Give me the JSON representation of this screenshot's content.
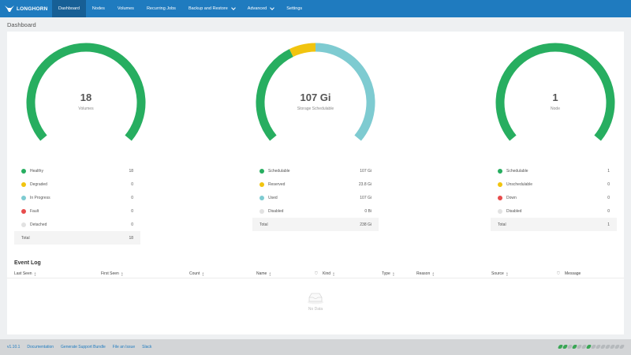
{
  "app": {
    "logo_text": "LONGHORN"
  },
  "nav": [
    {
      "label": "Dashboard",
      "active": true,
      "dropdown": false
    },
    {
      "label": "Nodes",
      "active": false,
      "dropdown": false
    },
    {
      "label": "Volumes",
      "active": false,
      "dropdown": false
    },
    {
      "label": "Recurring Jobs",
      "active": false,
      "dropdown": false
    },
    {
      "label": "Backup and Restore",
      "active": false,
      "dropdown": true
    },
    {
      "label": "Advanced",
      "active": false,
      "dropdown": true
    },
    {
      "label": "Settings",
      "active": false,
      "dropdown": false
    }
  ],
  "page": {
    "title": "Dashboard"
  },
  "colors": {
    "green": "#27ae60",
    "yellow": "#f1c40f",
    "teal": "#7ecbd1",
    "red": "#e74c4c",
    "grey": "#e2e2e2",
    "brand": "#1f7bbf"
  },
  "volumes": {
    "value": "18",
    "label": "Volumes",
    "segments": [
      {
        "fraction": 1.0,
        "color": "#27ae60"
      }
    ],
    "rows": [
      {
        "name": "Healthy",
        "value": "18",
        "color": "#27ae60"
      },
      {
        "name": "Degraded",
        "value": "0",
        "color": "#f1c40f"
      },
      {
        "name": "In Progress",
        "value": "0",
        "color": "#7ecbd1"
      },
      {
        "name": "Fault",
        "value": "0",
        "color": "#e74c4c"
      },
      {
        "name": "Detached",
        "value": "0",
        "color": "#e2e2e2"
      }
    ],
    "total_label": "Total",
    "total_value": "18"
  },
  "storage": {
    "value": "107 Gi",
    "label": "Storage Schedulable",
    "segments": [
      {
        "fraction": 0.4,
        "color": "#27ae60"
      },
      {
        "fraction": 0.1,
        "color": "#f1c40f"
      },
      {
        "fraction": 0.5,
        "color": "#7ecbd1"
      }
    ],
    "rows": [
      {
        "name": "Schedulable",
        "value": "107 Gi",
        "color": "#27ae60"
      },
      {
        "name": "Reserved",
        "value": "23.8 Gi",
        "color": "#f1c40f"
      },
      {
        "name": "Used",
        "value": "107 Gi",
        "color": "#7ecbd1"
      },
      {
        "name": "Disabled",
        "value": "0 Bi",
        "color": "#e2e2e2"
      }
    ],
    "total_label": "Total",
    "total_value": "238 Gi"
  },
  "nodes": {
    "value": "1",
    "label": "Node",
    "segments": [
      {
        "fraction": 1.0,
        "color": "#27ae60"
      }
    ],
    "rows": [
      {
        "name": "Schedulable",
        "value": "1",
        "color": "#27ae60"
      },
      {
        "name": "Unschedulable",
        "value": "0",
        "color": "#f1c40f"
      },
      {
        "name": "Down",
        "value": "0",
        "color": "#e74c4c"
      },
      {
        "name": "Disabled",
        "value": "0",
        "color": "#e2e2e2"
      }
    ],
    "total_label": "Total",
    "total_value": "1"
  },
  "event_log": {
    "title": "Event Log",
    "columns": [
      {
        "label": "Last Seen",
        "sortable": true,
        "filter": false
      },
      {
        "label": "First Seen",
        "sortable": true,
        "filter": false
      },
      {
        "label": "Count",
        "sortable": true,
        "filter": false
      },
      {
        "label": "Name",
        "sortable": true,
        "filter": true
      },
      {
        "label": "Kind",
        "sortable": true,
        "filter": false
      },
      {
        "label": "Type",
        "sortable": true,
        "filter": false
      },
      {
        "label": "Reason",
        "sortable": true,
        "filter": false
      },
      {
        "label": "Source",
        "sortable": true,
        "filter": true
      },
      {
        "label": "Message",
        "sortable": false,
        "filter": false
      }
    ],
    "empty_text": "No Data"
  },
  "footer": {
    "version": "v1.10.1",
    "links": [
      "Documentation",
      "Generate Support Bundle",
      "File an Issue",
      "Slack"
    ],
    "pills": [
      true,
      true,
      false,
      true,
      false,
      false,
      true,
      false,
      false,
      false,
      false,
      false,
      false,
      false
    ]
  }
}
